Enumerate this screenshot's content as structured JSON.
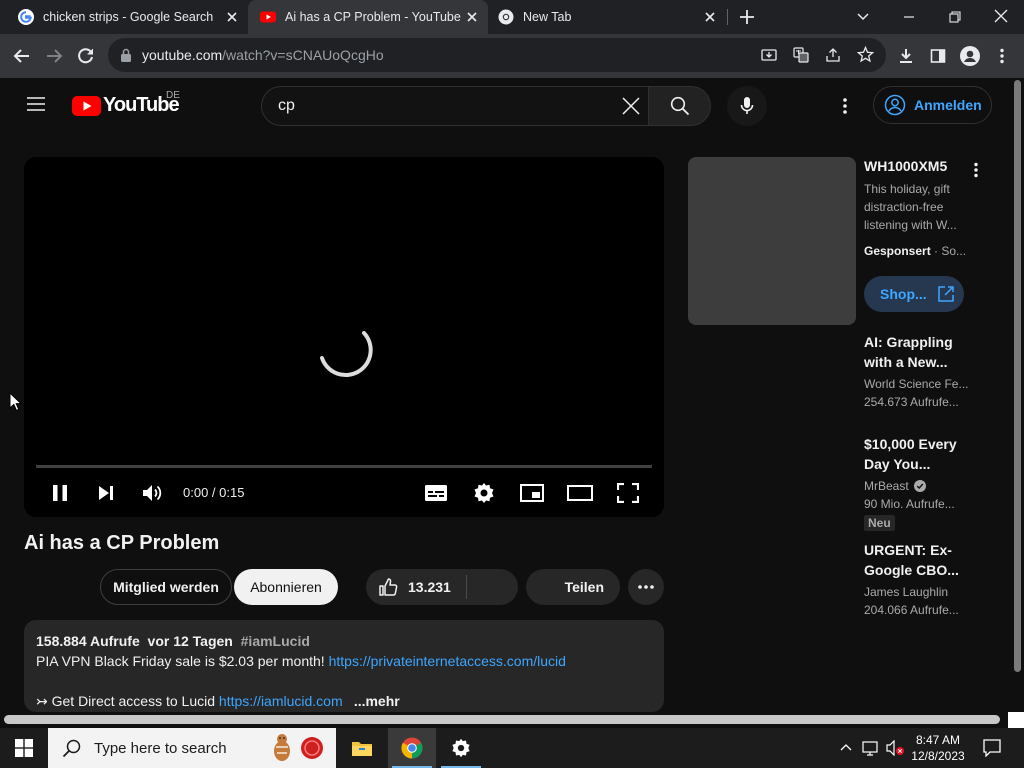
{
  "browser": {
    "tabs": [
      {
        "title": "chicken strips - Google Search",
        "favicon": "google-icon",
        "active": false
      },
      {
        "title": "Ai has a CP Problem - YouTube",
        "favicon": "youtube-icon",
        "active": true
      },
      {
        "title": "New Tab",
        "favicon": "chrome-icon",
        "active": false
      }
    ],
    "address": {
      "host": "youtube.com",
      "path": "/watch?v=sCNAUoQcgHo"
    }
  },
  "youtube": {
    "logo_text": "YouTube",
    "country_code": "DE",
    "search_query": "cp",
    "signin_label": "Anmelden",
    "player": {
      "time": "0:00 / 0:15",
      "state": "loading",
      "progress": 0
    },
    "video": {
      "title": "Ai has a CP Problem",
      "member_label": "Mitglied werden",
      "subscribe_label": "Abonnieren",
      "likes": "13.231",
      "share_label": "Teilen",
      "description": {
        "views": "158.884 Aufrufe",
        "age": "vor 12 Tagen",
        "hashtag": "#iamLucid",
        "line2_text": "PIA VPN Black Friday sale is $2.03 per month!",
        "line2_link": "https://privateinternetaccess.com/lucid",
        "line3_text": "↣ Get Direct access to Lucid",
        "line3_link": "https://iamlucid.com",
        "more_label": "...mehr"
      }
    },
    "sidebar": {
      "ad": {
        "title": "WH1000XM5",
        "desc_line1": "This holiday, gift",
        "desc_line2": "distraction-free",
        "desc_line3": "listening with W...",
        "sponsored": "Gesponsert",
        "sponsor_suffix": "So...",
        "shop_label": "Shop..."
      },
      "videos": [
        {
          "title_line1": "AI: Grappling",
          "title_line2": "with a New...",
          "channel": "World Science Fe...",
          "views": "254.673 Aufrufe...",
          "badge": ""
        },
        {
          "title_line1": "$10,000 Every",
          "title_line2": "Day You...",
          "channel": "MrBeast",
          "views": "90 Mio. Aufrufe...",
          "badge": "Neu",
          "verified": true
        },
        {
          "title_line1": "URGENT: Ex-",
          "title_line2": "Google CBO...",
          "channel": "James Laughlin",
          "views": "204.066 Aufrufe...",
          "badge": ""
        }
      ]
    }
  },
  "taskbar": {
    "search_placeholder": "Type here to search",
    "time": "8:47 AM",
    "date": "12/8/2023"
  },
  "colors": {
    "yt_red": "#ff0000",
    "link_blue": "#3ea6ff",
    "chrome_dark": "#202124"
  }
}
